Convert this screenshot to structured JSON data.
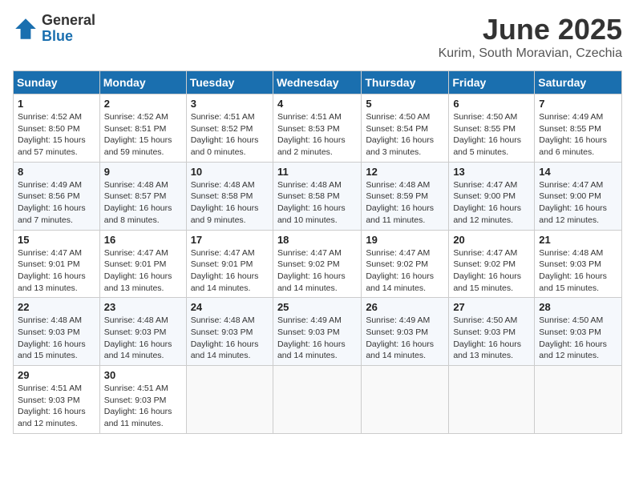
{
  "logo": {
    "general": "General",
    "blue": "Blue"
  },
  "title": "June 2025",
  "location": "Kurim, South Moravian, Czechia",
  "days_header": [
    "Sunday",
    "Monday",
    "Tuesday",
    "Wednesday",
    "Thursday",
    "Friday",
    "Saturday"
  ],
  "weeks": [
    [
      {
        "day": "1",
        "info": "Sunrise: 4:52 AM\nSunset: 8:50 PM\nDaylight: 15 hours\nand 57 minutes."
      },
      {
        "day": "2",
        "info": "Sunrise: 4:52 AM\nSunset: 8:51 PM\nDaylight: 15 hours\nand 59 minutes."
      },
      {
        "day": "3",
        "info": "Sunrise: 4:51 AM\nSunset: 8:52 PM\nDaylight: 16 hours\nand 0 minutes."
      },
      {
        "day": "4",
        "info": "Sunrise: 4:51 AM\nSunset: 8:53 PM\nDaylight: 16 hours\nand 2 minutes."
      },
      {
        "day": "5",
        "info": "Sunrise: 4:50 AM\nSunset: 8:54 PM\nDaylight: 16 hours\nand 3 minutes."
      },
      {
        "day": "6",
        "info": "Sunrise: 4:50 AM\nSunset: 8:55 PM\nDaylight: 16 hours\nand 5 minutes."
      },
      {
        "day": "7",
        "info": "Sunrise: 4:49 AM\nSunset: 8:55 PM\nDaylight: 16 hours\nand 6 minutes."
      }
    ],
    [
      {
        "day": "8",
        "info": "Sunrise: 4:49 AM\nSunset: 8:56 PM\nDaylight: 16 hours\nand 7 minutes."
      },
      {
        "day": "9",
        "info": "Sunrise: 4:48 AM\nSunset: 8:57 PM\nDaylight: 16 hours\nand 8 minutes."
      },
      {
        "day": "10",
        "info": "Sunrise: 4:48 AM\nSunset: 8:58 PM\nDaylight: 16 hours\nand 9 minutes."
      },
      {
        "day": "11",
        "info": "Sunrise: 4:48 AM\nSunset: 8:58 PM\nDaylight: 16 hours\nand 10 minutes."
      },
      {
        "day": "12",
        "info": "Sunrise: 4:48 AM\nSunset: 8:59 PM\nDaylight: 16 hours\nand 11 minutes."
      },
      {
        "day": "13",
        "info": "Sunrise: 4:47 AM\nSunset: 9:00 PM\nDaylight: 16 hours\nand 12 minutes."
      },
      {
        "day": "14",
        "info": "Sunrise: 4:47 AM\nSunset: 9:00 PM\nDaylight: 16 hours\nand 12 minutes."
      }
    ],
    [
      {
        "day": "15",
        "info": "Sunrise: 4:47 AM\nSunset: 9:01 PM\nDaylight: 16 hours\nand 13 minutes."
      },
      {
        "day": "16",
        "info": "Sunrise: 4:47 AM\nSunset: 9:01 PM\nDaylight: 16 hours\nand 13 minutes."
      },
      {
        "day": "17",
        "info": "Sunrise: 4:47 AM\nSunset: 9:01 PM\nDaylight: 16 hours\nand 14 minutes."
      },
      {
        "day": "18",
        "info": "Sunrise: 4:47 AM\nSunset: 9:02 PM\nDaylight: 16 hours\nand 14 minutes."
      },
      {
        "day": "19",
        "info": "Sunrise: 4:47 AM\nSunset: 9:02 PM\nDaylight: 16 hours\nand 14 minutes."
      },
      {
        "day": "20",
        "info": "Sunrise: 4:47 AM\nSunset: 9:02 PM\nDaylight: 16 hours\nand 15 minutes."
      },
      {
        "day": "21",
        "info": "Sunrise: 4:48 AM\nSunset: 9:03 PM\nDaylight: 16 hours\nand 15 minutes."
      }
    ],
    [
      {
        "day": "22",
        "info": "Sunrise: 4:48 AM\nSunset: 9:03 PM\nDaylight: 16 hours\nand 15 minutes."
      },
      {
        "day": "23",
        "info": "Sunrise: 4:48 AM\nSunset: 9:03 PM\nDaylight: 16 hours\nand 14 minutes."
      },
      {
        "day": "24",
        "info": "Sunrise: 4:48 AM\nSunset: 9:03 PM\nDaylight: 16 hours\nand 14 minutes."
      },
      {
        "day": "25",
        "info": "Sunrise: 4:49 AM\nSunset: 9:03 PM\nDaylight: 16 hours\nand 14 minutes."
      },
      {
        "day": "26",
        "info": "Sunrise: 4:49 AM\nSunset: 9:03 PM\nDaylight: 16 hours\nand 14 minutes."
      },
      {
        "day": "27",
        "info": "Sunrise: 4:50 AM\nSunset: 9:03 PM\nDaylight: 16 hours\nand 13 minutes."
      },
      {
        "day": "28",
        "info": "Sunrise: 4:50 AM\nSunset: 9:03 PM\nDaylight: 16 hours\nand 12 minutes."
      }
    ],
    [
      {
        "day": "29",
        "info": "Sunrise: 4:51 AM\nSunset: 9:03 PM\nDaylight: 16 hours\nand 12 minutes."
      },
      {
        "day": "30",
        "info": "Sunrise: 4:51 AM\nSunset: 9:03 PM\nDaylight: 16 hours\nand 11 minutes."
      },
      null,
      null,
      null,
      null,
      null
    ]
  ]
}
